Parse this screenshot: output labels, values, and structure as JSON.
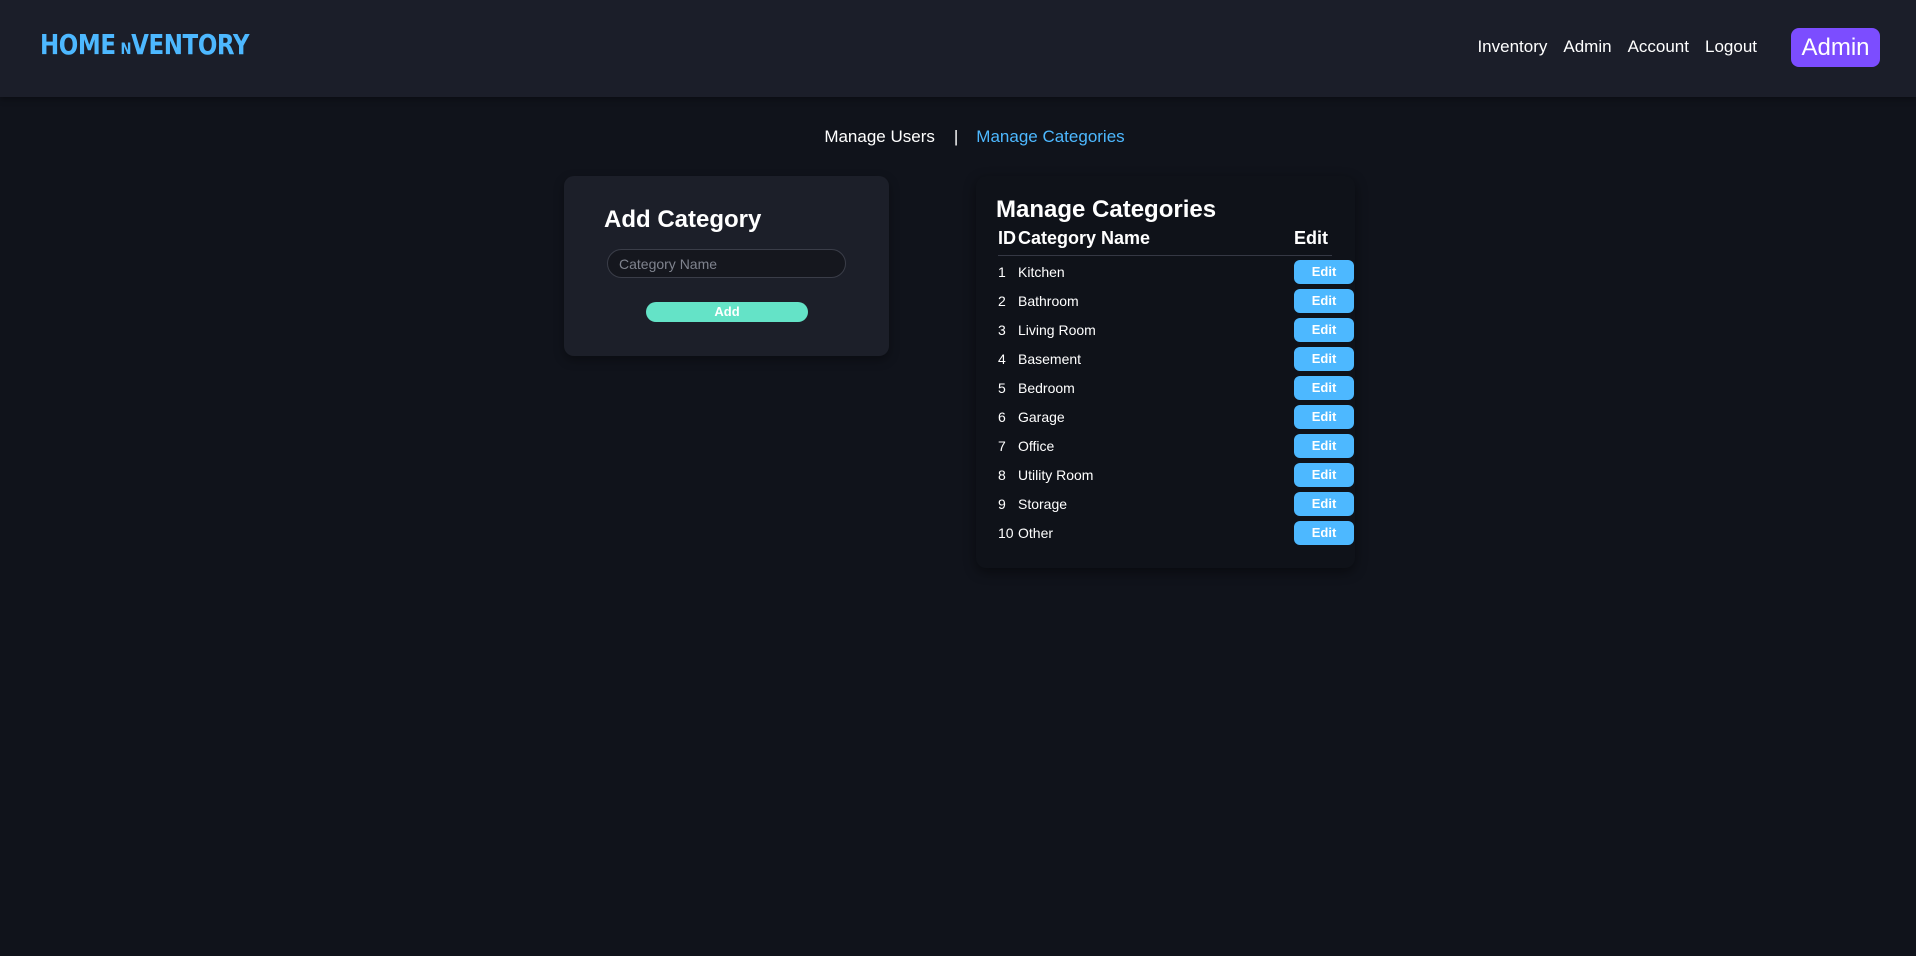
{
  "header": {
    "brand": {
      "part1": "HOME",
      "part2": "N",
      "part3": "VENTORY"
    },
    "nav": [
      "Inventory",
      "Admin",
      "Account",
      "Logout"
    ],
    "user_badge": "Admin"
  },
  "subnav": {
    "manage_users": "Manage Users",
    "separator": "|",
    "manage_categories": "Manage Categories"
  },
  "add_card": {
    "title": "Add Category",
    "input_placeholder": "Category Name",
    "button_label": "Add"
  },
  "manage_card": {
    "title": "Manage Categories",
    "columns": {
      "id": "ID",
      "name": "Category Name",
      "edit": "Edit"
    },
    "rows": [
      {
        "id": "1",
        "name": "Kitchen",
        "action": "Edit"
      },
      {
        "id": "2",
        "name": "Bathroom",
        "action": "Edit"
      },
      {
        "id": "3",
        "name": "Living Room",
        "action": "Edit"
      },
      {
        "id": "4",
        "name": "Basement",
        "action": "Edit"
      },
      {
        "id": "5",
        "name": "Bedroom",
        "action": "Edit"
      },
      {
        "id": "6",
        "name": "Garage",
        "action": "Edit"
      },
      {
        "id": "7",
        "name": "Office",
        "action": "Edit"
      },
      {
        "id": "8",
        "name": "Utility Room",
        "action": "Edit"
      },
      {
        "id": "9",
        "name": "Storage",
        "action": "Edit"
      },
      {
        "id": "10",
        "name": "Other",
        "action": "Edit"
      }
    ]
  },
  "colors": {
    "background": "#10131b",
    "header_bg": "#1b1e29",
    "accent_blue": "#4db8ff",
    "badge_purple": "#7c4dff",
    "add_green": "#64e3c7"
  }
}
